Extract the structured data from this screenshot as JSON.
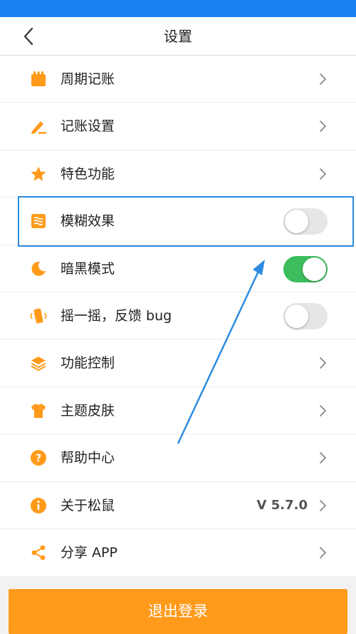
{
  "header": {
    "title": "设置",
    "back_icon": "chevron-left-icon"
  },
  "settings": [
    {
      "label": "周期记账",
      "icon": "calendar-icon",
      "control": "chevron"
    },
    {
      "label": "记账设置",
      "icon": "pencil-icon",
      "control": "chevron"
    },
    {
      "label": "特色功能",
      "icon": "star-icon",
      "control": "chevron"
    },
    {
      "label": "模糊效果",
      "icon": "blur-icon",
      "control": "toggle",
      "on": false
    },
    {
      "label": "暗黑模式",
      "icon": "moon-icon",
      "control": "toggle",
      "on": true
    },
    {
      "label": "摇一摇，反馈 bug",
      "icon": "shake-phone-icon",
      "control": "toggle",
      "on": false
    },
    {
      "label": "功能控制",
      "icon": "layers-icon",
      "control": "chevron"
    },
    {
      "label": "主题皮肤",
      "icon": "tshirt-icon",
      "control": "chevron"
    },
    {
      "label": "帮助中心",
      "icon": "help-icon",
      "control": "chevron"
    },
    {
      "label": "关于松鼠",
      "icon": "info-icon",
      "control": "chevron",
      "value": "V 5.7.0"
    },
    {
      "label": "分享 APP",
      "icon": "share-icon",
      "control": "chevron"
    }
  ],
  "logout": {
    "label": "退出登录"
  },
  "colors": {
    "status_bar": "#1a82f2",
    "accent_orange": "#ff9a1b",
    "toggle_on": "#3dbd5d",
    "annotation_blue": "#2d8ce0"
  }
}
